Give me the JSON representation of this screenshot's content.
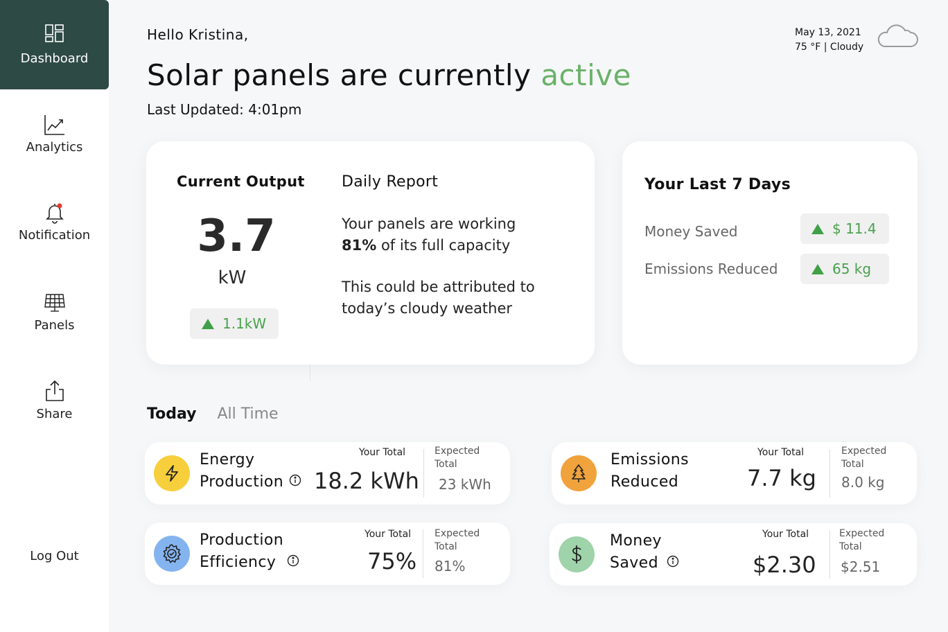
{
  "sidebar": {
    "items": [
      {
        "label": "Dashboard",
        "icon": "dashboard-icon",
        "active": true
      },
      {
        "label": "Analytics",
        "icon": "analytics-icon"
      },
      {
        "label": "Notification",
        "icon": "bell-icon"
      },
      {
        "label": "Panels",
        "icon": "solar-panel-icon"
      },
      {
        "label": "Share",
        "icon": "share-icon"
      }
    ],
    "logout": "Log Out"
  },
  "header": {
    "greeting": "Hello Kristina,",
    "headline_prefix": "Solar panels are currently",
    "headline_status": "active",
    "last_updated": "Last Updated: 4:01pm"
  },
  "weather": {
    "date": "May 13, 2021",
    "conditions": "75 °F | Cloudy",
    "icon": "cloud-icon"
  },
  "current_output": {
    "title": "Current Output",
    "value": "3.7",
    "unit": "kW",
    "change": "1.1kW"
  },
  "daily_report": {
    "title": "Daily Report",
    "line1_prefix": "Your panels are working",
    "line1_bold": "81%",
    "line1_suffix": "of its full capacity",
    "line2a": "This could be attributed to",
    "line2b": "today’s cloudy weather"
  },
  "last_7_days": {
    "title": "Your Last 7 Days",
    "rows": [
      {
        "label": "Money Saved",
        "value": "$ 11.4"
      },
      {
        "label": "Emissions Reduced",
        "value": "65 kg"
      }
    ]
  },
  "tabs": [
    "Today",
    "All Time"
  ],
  "stats": [
    {
      "name1": "Energy",
      "name2": "Production",
      "your_total_label": "Your Total",
      "your_total": "18.2 kWh",
      "expected_label1": "Expected",
      "expected_label2": "Total",
      "expected": "23 kWh",
      "color": "#f7cf3c",
      "icon": "lightning-icon"
    },
    {
      "name1": "Emissions",
      "name2": "Reduced",
      "your_total_label": "Your Total",
      "your_total": "7.7 kg",
      "expected_label1": "Expected",
      "expected_label2": "Total",
      "expected": "8.0 kg",
      "color": "#f0a33c",
      "icon": "tree-icon"
    },
    {
      "name1": "Production",
      "name2": "Efficiency",
      "your_total_label": "Your Total",
      "your_total": "75%",
      "expected_label1": "Expected",
      "expected_label2": "Total",
      "expected": "81%",
      "color": "#84b4f0",
      "icon": "gear-icon"
    },
    {
      "name1": "Money",
      "name2": "Saved",
      "your_total_label": "Your Total",
      "your_total": "$2.30",
      "expected_label1": "Expected",
      "expected_label2": "Total",
      "expected": "$2.51",
      "color": "#9fd3a9",
      "icon": "dollar-icon"
    }
  ],
  "colors": {
    "sidebar_active": "#2e4a44",
    "accent_green": "#6ab268",
    "up_green": "#3fa047",
    "notification_dot": "#e53935"
  }
}
